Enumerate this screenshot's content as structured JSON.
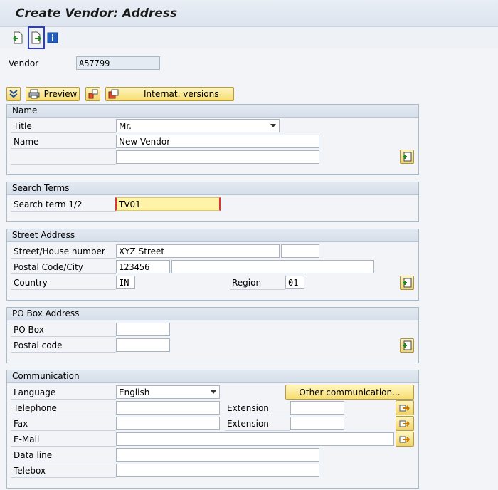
{
  "title": "Create Vendor: Address",
  "vendor": {
    "label": "Vendor",
    "value": "A57799"
  },
  "buttons": {
    "preview": "Preview",
    "internat": "Internat. versions",
    "other_comm": "Other communication..."
  },
  "name_group": {
    "header": "Name",
    "title_label": "Title",
    "title_value": "Mr.",
    "name_label": "Name",
    "name_value": "New Vendor",
    "name2_value": ""
  },
  "search_group": {
    "header": "Search Terms",
    "label": "Search term 1/2",
    "value": "TV01"
  },
  "street_group": {
    "header": "Street Address",
    "street_label": "Street/House number",
    "street_value": "XYZ Street",
    "house_value": "",
    "postal_label": "Postal Code/City",
    "postal_value": "123456",
    "city_value": "",
    "country_label": "Country",
    "country_value": "IN",
    "region_label": "Region",
    "region_value": "01"
  },
  "pobox_group": {
    "header": "PO Box Address",
    "pobox_label": "PO Box",
    "pobox_value": "",
    "postal_label": "Postal code",
    "postal_value": ""
  },
  "comm_group": {
    "header": "Communication",
    "language_label": "Language",
    "language_value": "English",
    "telephone_label": "Telephone",
    "telephone_value": "",
    "ext_label": "Extension",
    "ext_value": "",
    "fax_label": "Fax",
    "fax_value": "",
    "fax_ext_label": "Extension",
    "fax_ext_value": "",
    "email_label": "E-Mail",
    "email_value": "",
    "dataline_label": "Data line",
    "dataline_value": "",
    "telebox_label": "Telebox",
    "telebox_value": ""
  },
  "colors": {
    "accent": "#2a3bd1",
    "button_yellow": "#f7dd70",
    "highlight": "#fff3a8"
  }
}
